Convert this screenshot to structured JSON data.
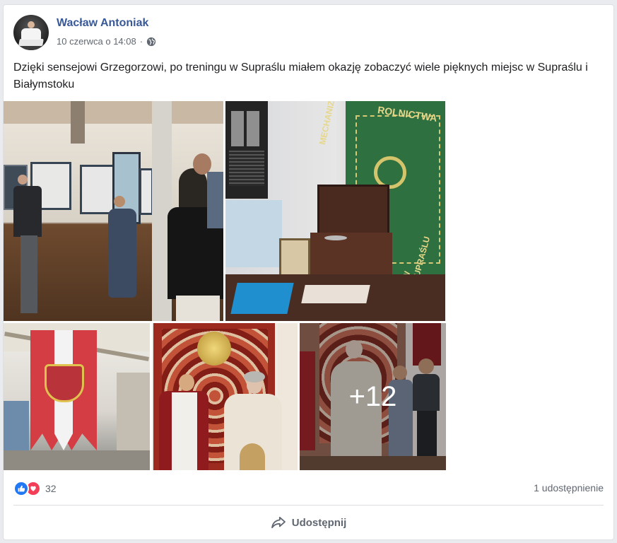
{
  "post": {
    "author": "Wacław Antoniak",
    "date": "10 czerwca o 14:08",
    "date_separator": "·",
    "privacy_icon": "globe-icon",
    "text": "Dzięki sensejowi Grzegorzowi, po treningu w Supraślu miałem okazję zobaczyć wiele pięknych miejsc w Supraślu i Białymstoku"
  },
  "gallery": {
    "more_label": "+12"
  },
  "photo_banner_text": {
    "line1": "ROLNICTWA",
    "line2": "MECHANIZACJI",
    "line3": "W SUPRAŚLU"
  },
  "engagement": {
    "reaction_icons": [
      "like-icon",
      "love-icon"
    ],
    "reactions_count": "32",
    "shares_label": "1 udostępnienie"
  },
  "actions": {
    "share_label": "Udostępnij",
    "share_icon": "share-arrow-icon"
  },
  "colors": {
    "author_link": "#385898",
    "like_blue": "#2078f4",
    "love_red": "#f33e58",
    "meta_gray": "#606770"
  }
}
